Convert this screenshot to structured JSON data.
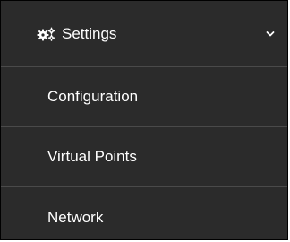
{
  "menu": {
    "header": {
      "label": "Settings",
      "icon": "gears-icon",
      "expand_icon": "chevron-down-icon"
    },
    "items": [
      {
        "label": "Configuration"
      },
      {
        "label": "Virtual Points"
      },
      {
        "label": "Network"
      }
    ]
  },
  "colors": {
    "background": "#2b2b2b",
    "text": "#ffffff",
    "divider": "#4a4a4a"
  }
}
